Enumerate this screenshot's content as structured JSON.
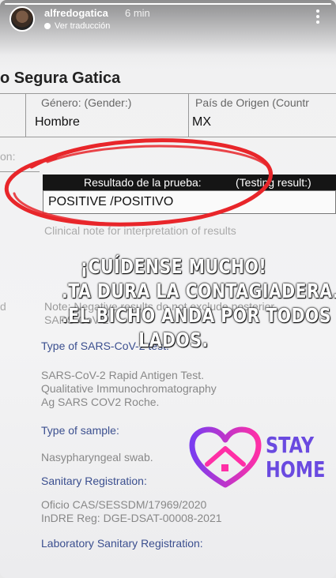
{
  "story": {
    "username": "alfredogatica",
    "time_ago": "6 min",
    "translate_label": "Ver traducción",
    "progress": 1.0
  },
  "document": {
    "name_partial": "o Segura  Gatica",
    "gender_label": "Género:    (Gender:)",
    "gender_value": "Hombre",
    "country_label": "País de Origen    (Countr",
    "country_value": "MX",
    "row_label_left": "on:",
    "result_header_es": "Resultado de la prueba:",
    "result_header_en": "(Testing result:)",
    "result_value": "POSITIVE /POSITIVO",
    "clinical_note": "Clinical note for interpretation of results",
    "note_partial": "Note: Negative results do not exclude posterior",
    "note_partial2": "SARS-CoV-2",
    "row_label_left2": "d",
    "type_test_label": "Type of SARS-CoV-2 test:",
    "type_test_lines": [
      "SARS-CoV-2 Rapid Antigen Test.",
      "Qualitative Immunochromatography",
      "Ag SARS COV2 Roche."
    ],
    "sample_label": "Type of sample:",
    "sample_value": "Nasypharyngeal swab.",
    "sanitary_label": "Sanitary Registration:",
    "sanitary_lines": [
      "Oficio CAS/SESSDM/17969/2020",
      "InDRE Reg: DGE-DSAT-00008-2021"
    ],
    "lab_label": "Laboratory Sanitary Registration:"
  },
  "overlay": {
    "lines": [
      "¡CUÍDENSE MUCHO!",
      ".TA DURA LA CONTAGIADERA.",
      ".EL BICHO ANDA POR TODOS",
      "LADOS."
    ]
  },
  "sticker": {
    "line1": "STAY",
    "line2": "HOME",
    "color_text": "#6a4ae0",
    "color_heart_left": "#7a3cf0",
    "color_heart_right": "#ff2fa6"
  },
  "colors": {
    "highlight_red": "#e8262a"
  },
  "icons": {
    "more": "more-vertical-icon",
    "translate": "globe-icon"
  }
}
